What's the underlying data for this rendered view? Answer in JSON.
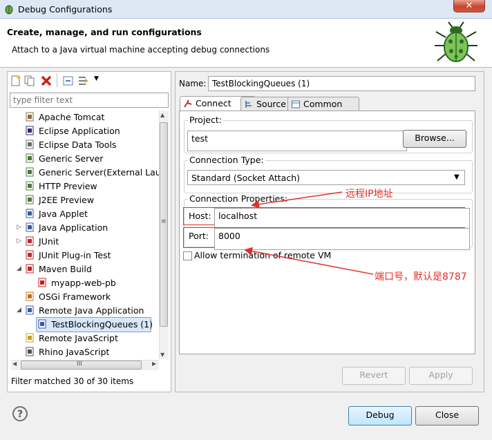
{
  "window": {
    "title": "Debug Configurations",
    "close": "✕"
  },
  "header": {
    "title": "Create, manage, and run configurations",
    "subtitle": "Attach to a Java virtual machine accepting debug connections"
  },
  "sidebar": {
    "filter_placeholder": "type filter text",
    "tree": [
      {
        "label": "Apache Tomcat",
        "icon": "tomcat-icon"
      },
      {
        "label": "Eclipse Application",
        "icon": "eclipse-icon"
      },
      {
        "label": "Eclipse Data Tools",
        "icon": "database-icon"
      },
      {
        "label": "Generic Server",
        "icon": "server-icon"
      },
      {
        "label": "Generic Server(External Launch)",
        "icon": "server-icon"
      },
      {
        "label": "HTTP Preview",
        "icon": "server-icon"
      },
      {
        "label": "J2EE Preview",
        "icon": "server-icon"
      },
      {
        "label": "Java Applet",
        "icon": "applet-icon"
      },
      {
        "label": "Java Application",
        "icon": "java-app-icon"
      },
      {
        "label": "JUnit",
        "icon": "junit-icon"
      },
      {
        "label": "JUnit Plug-in Test",
        "icon": "junit-icon"
      },
      {
        "label": "Maven Build",
        "icon": "maven-icon"
      },
      {
        "label": "myapp-web-pb",
        "icon": "maven-icon"
      },
      {
        "label": "OSGi Framework",
        "icon": "osgi-icon"
      },
      {
        "label": "Remote Java Application",
        "icon": "remote-java-icon"
      },
      {
        "label": "TestBlockingQueues (1)",
        "icon": "remote-java-icon"
      },
      {
        "label": "Remote JavaScript",
        "icon": "javascript-icon"
      },
      {
        "label": "Rhino JavaScript",
        "icon": "rhino-icon"
      }
    ],
    "hscroll_grip": "III",
    "vscroll_grip": "≡",
    "status": "Filter matched 30 of 30 items"
  },
  "form": {
    "name_label": "Name:",
    "name_value": "TestBlockingQueues (1)",
    "tabs": [
      {
        "label": "Connect"
      },
      {
        "label": "Source"
      },
      {
        "label": "Common"
      }
    ],
    "project_label": "Project:",
    "project_value": "test",
    "browse_label": "Browse...",
    "connection_type_label": "Connection Type:",
    "connection_type_value": "Standard (Socket Attach)",
    "connection_props_label": "Connection Properties:",
    "host_label": "Host:",
    "host_value": "localhost",
    "port_label": "Port:",
    "port_value": "8000",
    "allow_termination_label": "Allow termination of remote VM",
    "revert_label": "Revert",
    "apply_label": "Apply"
  },
  "annotations": {
    "remote_ip": "远程IP地址",
    "port_note": "端口号，默认是8787",
    "color": "#e0302a"
  },
  "footer": {
    "help": "?",
    "debug_label": "Debug",
    "close_label": "Close"
  }
}
